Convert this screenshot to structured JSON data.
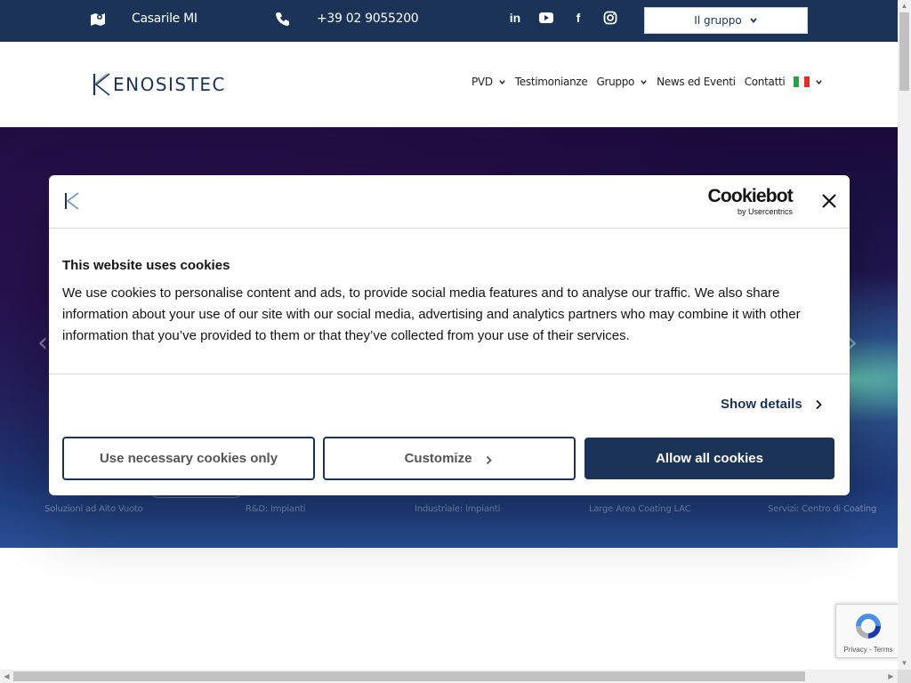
{
  "topbar": {
    "location": "Casarile MI",
    "phone": "+39 02 9055200",
    "socials": [
      "linkedin-icon",
      "youtube-icon",
      "facebook-icon",
      "instagram-icon"
    ],
    "social_glyphs": {
      "linkedin": "in",
      "facebook": "f"
    },
    "gruppo_label": "Il gruppo"
  },
  "header": {
    "logo_text": "KENOSISTEC",
    "logo_rest": "ENOSISTEC",
    "nav": [
      {
        "label": "PVD",
        "dropdown": true
      },
      {
        "label": "Testimonianze",
        "dropdown": false
      },
      {
        "label": "Gruppo",
        "dropdown": true
      },
      {
        "label": "News ed Eventi",
        "dropdown": false
      },
      {
        "label": "Contatti",
        "dropdown": false
      }
    ],
    "language": "it"
  },
  "hero": {
    "tabs": [
      "Soluzioni ad Alto Vuoto",
      "R&D: Impianti",
      "Industriale: impianti",
      "Large Area Coating LAC",
      "Servizi: Centro di Coating"
    ],
    "arrow_left": "‹",
    "arrow_right": "›"
  },
  "cookie": {
    "brand_main": "Cookiebot",
    "brand_sub": "by Usercentrics",
    "title": "This website uses cookies",
    "body": "We use cookies to personalise content and ads, to provide social media features and to analyse our traffic. We also share information about your use of our site with our social media, advertising and analytics partners who may combine it with other information that you’ve provided to them or that they’ve collected from your use of their services.",
    "show_details": "Show details",
    "btn_necessary": "Use necessary cookies only",
    "btn_customize": "Customize",
    "btn_allow": "Allow all cookies"
  },
  "recaptcha": {
    "terms": "Privacy - Terms"
  },
  "colors": {
    "navy": "#1a3357",
    "text": "#141414"
  }
}
